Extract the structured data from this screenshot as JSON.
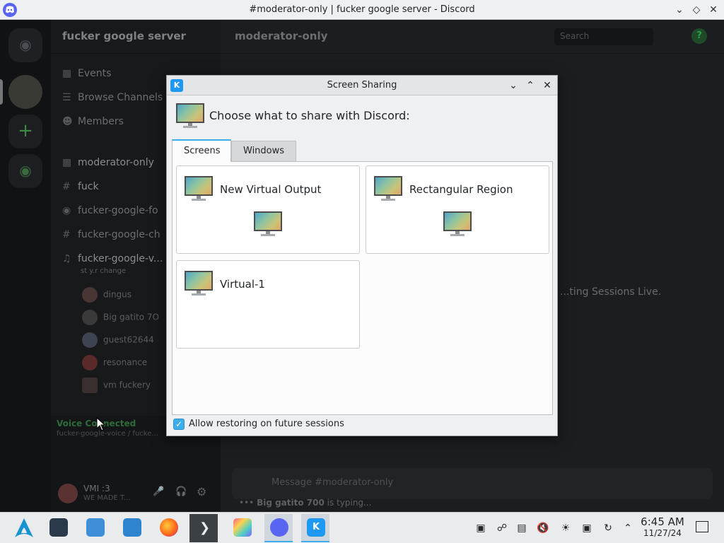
{
  "window": {
    "title": "#moderator-only | fucker google server - Discord",
    "controls": [
      "minimize",
      "maximize",
      "close"
    ]
  },
  "discord": {
    "server_name": "fucker google server",
    "channel_header": "moderator-only",
    "search_placeholder": "Search",
    "sidebar": [
      {
        "icon": "calendar-icon",
        "label": "Events"
      },
      {
        "icon": "browse-icon",
        "label": "Browse Channels"
      },
      {
        "icon": "members-icon",
        "label": "Members"
      }
    ],
    "channels": [
      {
        "icon": "text-channel-icon",
        "label": "moderator-only"
      },
      {
        "icon": "hash-icon",
        "label": "fuck"
      },
      {
        "icon": "forum-icon",
        "label": "fucker-google-fo"
      },
      {
        "icon": "hash-icon",
        "label": "fucker-google-ch"
      },
      {
        "icon": "speaker-icon",
        "label": "fucker-google-v..."
      }
    ],
    "voice_status_sub": "st y.r change",
    "voice_users": [
      "dingus",
      "Big gatito 7O",
      "guest62644",
      "resonance",
      "vm fuckery"
    ],
    "voice_connected": "Voice Connected",
    "voice_connected_sub": "fucker-google-voice / fucke...",
    "user": {
      "name": "VMI :3",
      "status": "WE MADE T..."
    },
    "main_hint": "...ting Sessions Live.",
    "message_placeholder": "Message #moderator-only",
    "typing": {
      "user": "Big gatito 700",
      "suffix": "is typing..."
    }
  },
  "dialog": {
    "title": "Screen Sharing",
    "prompt": "Choose what to share with Discord:",
    "tabs": [
      {
        "label": "Screens",
        "active": true
      },
      {
        "label": "Windows",
        "active": false
      }
    ],
    "sources": [
      {
        "label": "New Virtual Output"
      },
      {
        "label": "Rectangular Region"
      },
      {
        "label": "Virtual-1"
      }
    ],
    "restore_checkbox": {
      "label": "Allow restoring on future sessions",
      "checked": true
    },
    "colors": {
      "accent": "#3daee9",
      "kde_blue": "#1d99f3"
    }
  },
  "taskbar": {
    "apps": [
      "arch-launcher-icon",
      "system-settings-icon",
      "discover-icon",
      "file-manager-icon",
      "firefox-icon",
      "terminal-icon",
      "image-viewer-icon",
      "discord-icon",
      "kde-connect-icon"
    ],
    "tray": [
      "discord-tray-icon",
      "network-icon",
      "clipboard-icon",
      "volume-muted-icon",
      "brightness-icon",
      "disk-icon",
      "updates-icon",
      "tray-expand-icon"
    ],
    "time": "6:45 AM",
    "date": "11/27/24"
  }
}
